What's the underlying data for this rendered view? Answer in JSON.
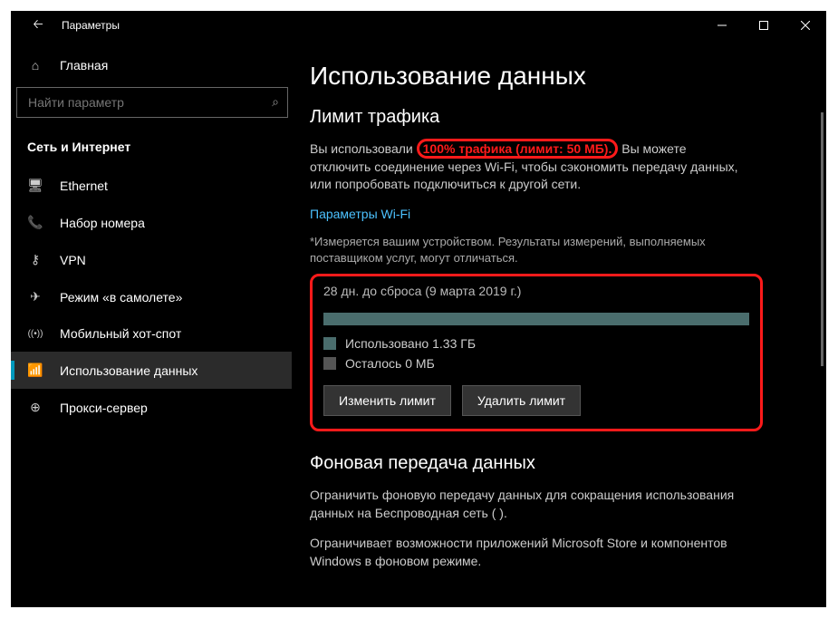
{
  "titlebar": {
    "title": "Параметры"
  },
  "sidebar": {
    "home": "Главная",
    "search_placeholder": "Найти параметр",
    "category": "Сеть и Интернет",
    "items": [
      {
        "label": "Ethernet",
        "icon": "🖥"
      },
      {
        "label": "Набор номера",
        "icon": "📞"
      },
      {
        "label": "VPN",
        "icon": "⚷"
      },
      {
        "label": "Режим «в самолете»",
        "icon": "✈"
      },
      {
        "label": "Мобильный хот-спот",
        "icon": "((•))"
      },
      {
        "label": "Использование данных",
        "icon": "📶",
        "active": true
      },
      {
        "label": "Прокси-сервер",
        "icon": "⊕"
      }
    ]
  },
  "content": {
    "h1": "Использование данных",
    "h2_limit": "Лимит трафика",
    "usage_prefix": "Вы использовали",
    "usage_highlight": "100% трафика (лимит: 50 МБ).",
    "usage_suffix": "Вы можете отключить соединение через Wi-Fi, чтобы сэкономить передачу данных, или попробовать подключиться к другой сети.",
    "wifi_link": "Параметры Wi-Fi",
    "note": "*Измеряется вашим устройством. Результаты измерений, выполняемых поставщиком услуг, могут отличаться.",
    "reset_info": "28 дн. до сброса (9 марта 2019 г.)",
    "used_label": "Использовано 1.33 ГБ",
    "remaining_label": "Осталось 0 МБ",
    "btn_change": "Изменить лимит",
    "btn_remove": "Удалить лимит",
    "h2_bg": "Фоновая передача данных",
    "bg_para": "Ограничить фоновую передачу данных для сокращения использования данных на Беспроводная сеть (                    ).",
    "bg_para2": "Ограничивает возможности приложений Microsoft Store и компонентов Windows в фоновом режиме."
  },
  "colors": {
    "accent_highlight": "#ff1a1a",
    "progress_fill": "#4a6d6d",
    "link": "#4cc2ff"
  }
}
